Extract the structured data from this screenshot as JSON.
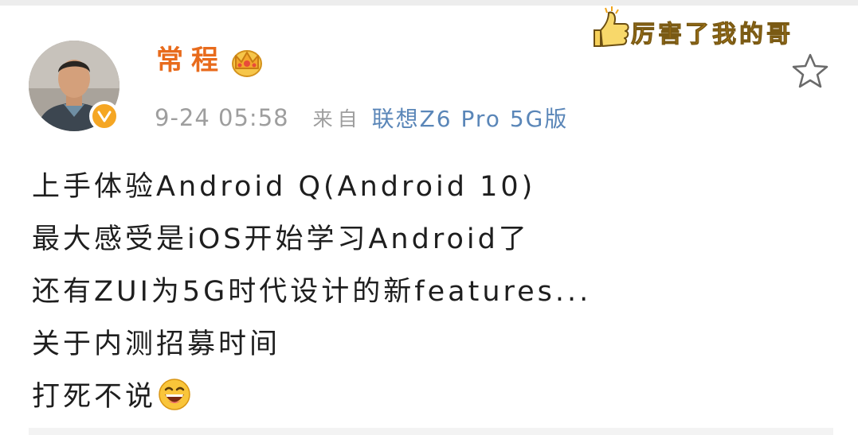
{
  "post": {
    "author": "常程",
    "timestamp": "9-24 05:58",
    "source_prefix": "来自",
    "source_device": "联想Z6 Pro 5G版",
    "sticker_text": "厉害了我的哥",
    "lines": [
      "上手体验Android Q(Android 10)",
      "最大感受是iOS开始学习Android了",
      "还有ZUI为5G时代设计的新features...",
      "关于内测招募时间",
      "打死不说"
    ]
  },
  "icons": {
    "verified": "verified-badge-icon",
    "crown": "crown-icon",
    "thumbs_up": "thumbs-up-icon",
    "favorite": "star-outline-icon",
    "emoji": "laughing-emoji-icon"
  },
  "colors": {
    "author": "#e86b1c",
    "device": "#5a86b8",
    "meta": "#9e9e9e",
    "verified": "#f5a623"
  }
}
